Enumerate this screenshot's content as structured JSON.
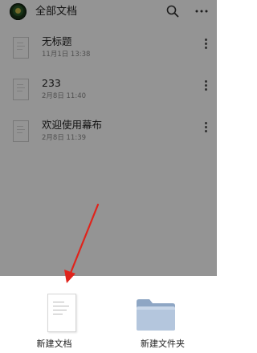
{
  "header": {
    "title": "全部文档",
    "search_icon": "search-icon",
    "more_icon": "more-vertical-icon"
  },
  "documents": [
    {
      "name": "无标题",
      "time": "11月1日 13:38"
    },
    {
      "name": "233",
      "time": "2月8日 11:40"
    },
    {
      "name": "欢迎使用幕布",
      "time": "2月8日 11:39"
    }
  ],
  "sheet": {
    "new_doc_label": "新建文档",
    "new_folder_label": "新建文件夹"
  },
  "colors": {
    "overlay": "#000000",
    "annotation_arrow": "#e0231b",
    "folder": "#a9bdd6"
  }
}
